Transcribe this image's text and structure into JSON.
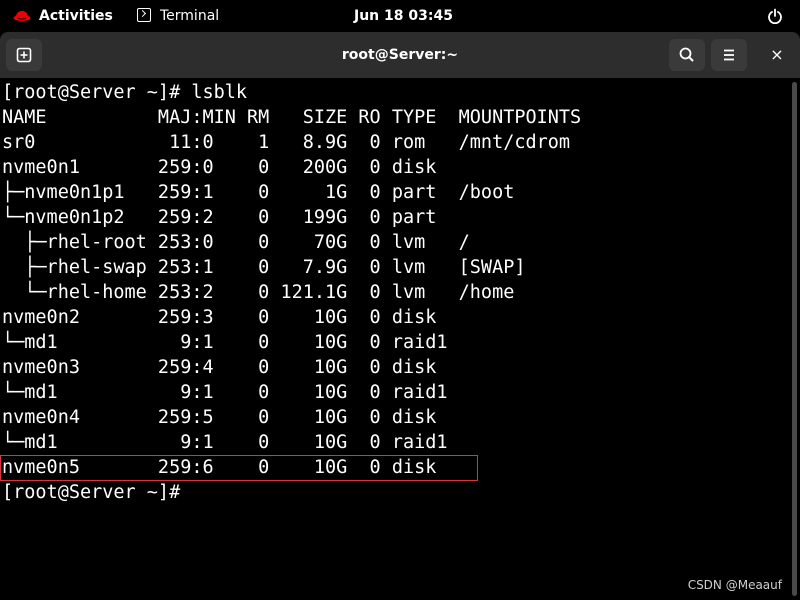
{
  "topbar": {
    "activities": "Activities",
    "app_name": "Terminal",
    "clock": "Jun 18  03:45"
  },
  "window": {
    "title": "root@Server:~",
    "close_glyph": "×"
  },
  "terminal": {
    "lines": [
      "[root@Server ~]# lsblk",
      "NAME          MAJ:MIN RM   SIZE RO TYPE  MOUNTPOINTS",
      "sr0            11:0    1   8.9G  0 rom   /mnt/cdrom",
      "nvme0n1       259:0    0   200G  0 disk",
      "├─nvme0n1p1   259:1    0     1G  0 part  /boot",
      "└─nvme0n1p2   259:2    0   199G  0 part",
      "  ├─rhel-root 253:0    0    70G  0 lvm   /",
      "  ├─rhel-swap 253:1    0   7.9G  0 lvm   [SWAP]",
      "  └─rhel-home 253:2    0 121.1G  0 lvm   /home",
      "nvme0n2       259:3    0    10G  0 disk",
      "└─md1           9:1    0    10G  0 raid1",
      "nvme0n3       259:4    0    10G  0 disk",
      "└─md1           9:1    0    10G  0 raid1",
      "nvme0n4       259:5    0    10G  0 disk",
      "└─md1           9:1    0    10G  0 raid1",
      "nvme0n5       259:6    0    10G  0 disk",
      "[root@Server ~]#"
    ]
  },
  "watermark": "CSDN @Meaauf",
  "colors": {
    "highlight": "#d9333f",
    "titlebar": "#2d2d2d",
    "button": "#3a3a3a"
  }
}
